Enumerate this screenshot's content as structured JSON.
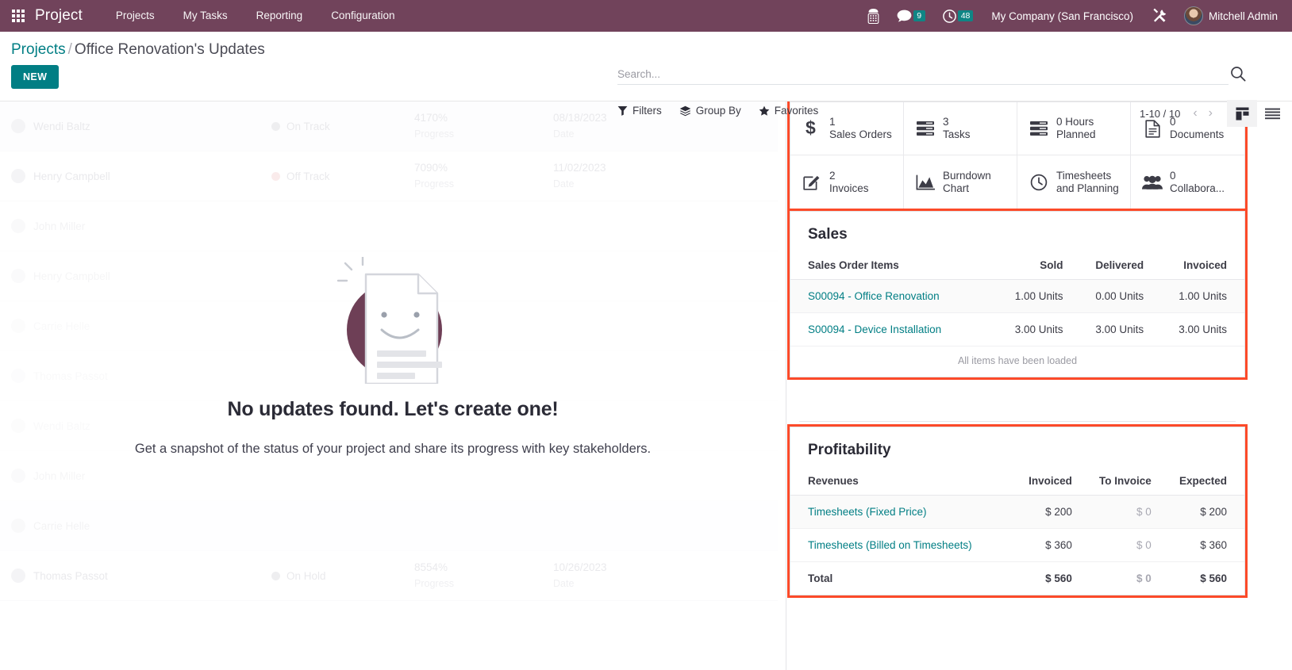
{
  "navbar": {
    "apps_icon": "apps-grid-icon",
    "brand": "Project",
    "menu": [
      {
        "label": "Projects"
      },
      {
        "label": "My Tasks"
      },
      {
        "label": "Reporting"
      },
      {
        "label": "Configuration"
      }
    ],
    "voip_icon": "phone-keypad-icon",
    "messages_icon": "chat-bubble-icon",
    "messages_count": "9",
    "activities_icon": "clock-icon",
    "activities_count": "48",
    "company": "My Company (San Francisco)",
    "debug_icon": "tools-icon",
    "user": "Mitchell Admin",
    "brand_color": "#71435b",
    "badge_color": "#0f8585"
  },
  "control_panel": {
    "breadcrumb_root": "Projects",
    "breadcrumb_sep": "/",
    "breadcrumb_current": "Office Renovation's Updates",
    "new_label": "NEW",
    "search": {
      "placeholder": "Search...",
      "value": "",
      "icon": "search-icon"
    },
    "filters_label": "Filters",
    "group_by_label": "Group By",
    "favorites_label": "Favorites",
    "pager": "1-10 / 10",
    "prev_arrow": "‹",
    "next_arrow": "›",
    "view_kanban_icon": "kanban-view-icon",
    "view_list_icon": "list-view-icon",
    "accent_color": "#017e84"
  },
  "empty_state": {
    "title": "No updates found. Let's create one!",
    "subtitle": "Get a snapshot of the status of your project and share its progress with key stakeholders.",
    "illustration": "smiling-document-icon"
  },
  "ghost_records": [
    {
      "name": "Wendi Baltz",
      "status": "On Track",
      "status_tone": "grey",
      "progress": "4170%",
      "progress_label": "Progress",
      "date": "08/18/2023",
      "date_label": "Date"
    },
    {
      "name": "Henry Campbell",
      "status": "Off Track",
      "status_tone": "red",
      "progress": "7090%",
      "progress_label": "Progress",
      "date": "11/02/2023",
      "date_label": "Date"
    },
    {
      "name": "John Miller",
      "status": "",
      "status_tone": "grey",
      "progress": "",
      "progress_label": "",
      "date": "",
      "date_label": ""
    },
    {
      "name": "Henry Campbell",
      "status": "",
      "status_tone": "grey",
      "progress": "",
      "progress_label": "",
      "date": "",
      "date_label": ""
    },
    {
      "name": "Carrie Helle",
      "status": "",
      "status_tone": "grey",
      "progress": "",
      "progress_label": "",
      "date": "",
      "date_label": ""
    },
    {
      "name": "Thomas Passot",
      "status": "",
      "status_tone": "grey",
      "progress": "",
      "progress_label": "",
      "date": "",
      "date_label": ""
    },
    {
      "name": "Wendi Baltz",
      "status": "",
      "status_tone": "grey",
      "progress": "",
      "progress_label": "",
      "date": "",
      "date_label": ""
    },
    {
      "name": "John Miller",
      "status": "",
      "status_tone": "grey",
      "progress": "",
      "progress_label": "",
      "date": "",
      "date_label": ""
    },
    {
      "name": "Carrie Helle",
      "status": "",
      "status_tone": "grey",
      "progress": "",
      "progress_label": "",
      "date": "",
      "date_label": ""
    },
    {
      "name": "Thomas Passot",
      "status": "On Hold",
      "status_tone": "grey",
      "progress": "8554%",
      "progress_label": "Progress",
      "date": "10/26/2023",
      "date_label": "Date"
    }
  ],
  "stat_buttons": [
    {
      "count": "1",
      "label": "Sales Orders",
      "icon": "dollar-icon"
    },
    {
      "count": "3",
      "label": "Tasks",
      "icon": "tasks-list-icon"
    },
    {
      "count": "0 Hours",
      "label": "Planned",
      "icon": "planned-list-icon"
    },
    {
      "count": "0",
      "label": "Documents",
      "icon": "document-icon"
    },
    {
      "count": "2",
      "label": "Invoices",
      "icon": "pencil-square-icon"
    },
    {
      "count": "",
      "label": "Burndown Chart",
      "icon": "area-chart-icon"
    },
    {
      "count": "",
      "label": "Timesheets and Planning",
      "icon": "clock-icon"
    },
    {
      "count": "0",
      "label": "Collabora...",
      "icon": "users-group-icon"
    }
  ],
  "sales": {
    "title": "Sales",
    "columns": [
      "Sales Order Items",
      "Sold",
      "Delivered",
      "Invoiced"
    ],
    "rows": [
      {
        "item": "S00094 - Office Renovation",
        "sold": "1.00 Units",
        "delivered": "0.00 Units",
        "invoiced": "1.00 Units"
      },
      {
        "item": "S00094 - Device Installation",
        "sold": "3.00 Units",
        "delivered": "3.00 Units",
        "invoiced": "3.00 Units"
      }
    ],
    "footer_note": "All items have been loaded"
  },
  "profitability": {
    "title": "Profitability",
    "columns": [
      "Revenues",
      "Invoiced",
      "To Invoice",
      "Expected"
    ],
    "rows": [
      {
        "label": "Timesheets (Fixed Price)",
        "invoiced": "$ 200",
        "to_invoice": "$ 0",
        "expected": "$ 200"
      },
      {
        "label": "Timesheets (Billed on Timesheets)",
        "invoiced": "$ 360",
        "to_invoice": "$ 0",
        "expected": "$ 360"
      }
    ],
    "total": {
      "label": "Total",
      "invoiced": "$ 560",
      "to_invoice": "$ 0",
      "expected": "$ 560"
    }
  },
  "highlight_color": "#fc4a29"
}
